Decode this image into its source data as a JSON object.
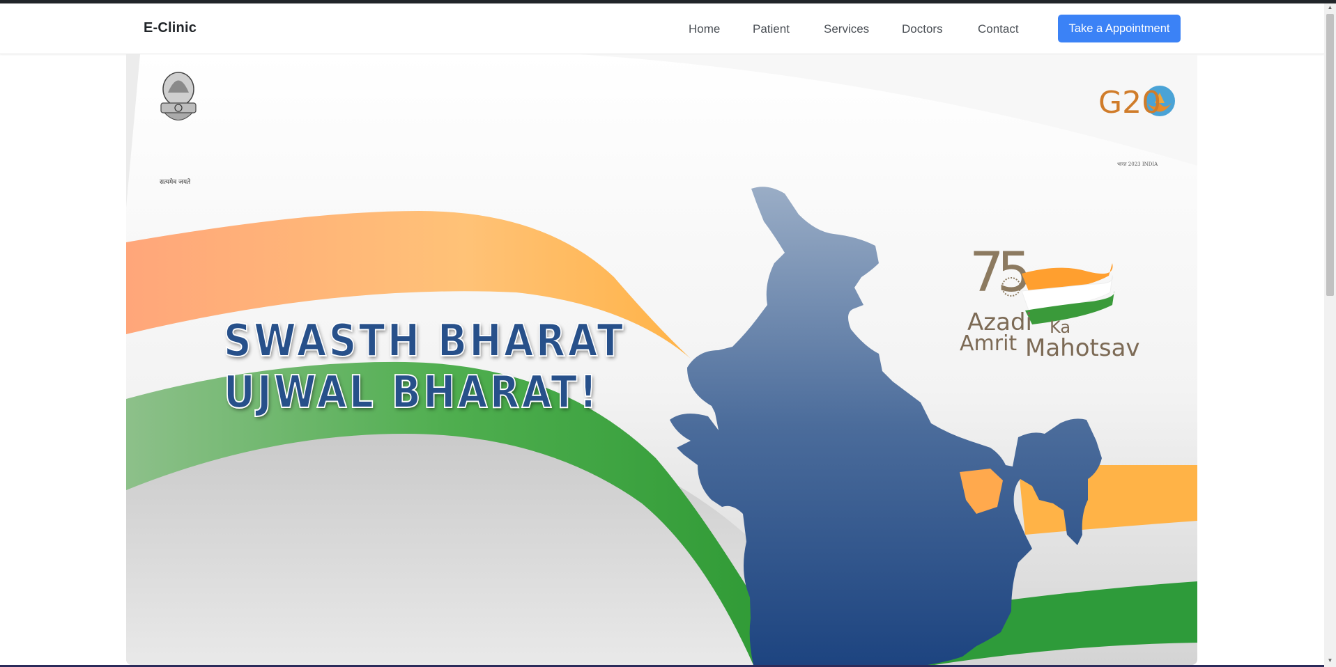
{
  "brand": "E-Clinic",
  "nav": {
    "links": [
      "Home",
      "Patient",
      "Services",
      "Doctors",
      "Contact"
    ],
    "cta_label": "Take a Appointment"
  },
  "hero": {
    "slogan_line1": "SWASTH BHARAT",
    "slogan_line2": "UJWAL BHARAT!",
    "emblem_motto": "सत्यमेव जयते",
    "g20_label": "G20",
    "g20_tag": "भारत 2023 INDIA",
    "akam": {
      "number": "75",
      "word1": "Azadi",
      "word2": "Ka",
      "word3": "Amrit",
      "word4": "Mahotsav"
    },
    "colors": {
      "saffron": "#ff9933",
      "green": "#2e9b3a",
      "map_top": "#9aadc6",
      "map_bottom": "#1d4480",
      "slogan": "#27508a"
    }
  },
  "icons": {
    "emblem": "state-emblem-icon",
    "g20": "g20-logo-icon",
    "akam": "azadi-ka-amrit-mahotsav-logo-icon",
    "map": "india-map-icon"
  }
}
